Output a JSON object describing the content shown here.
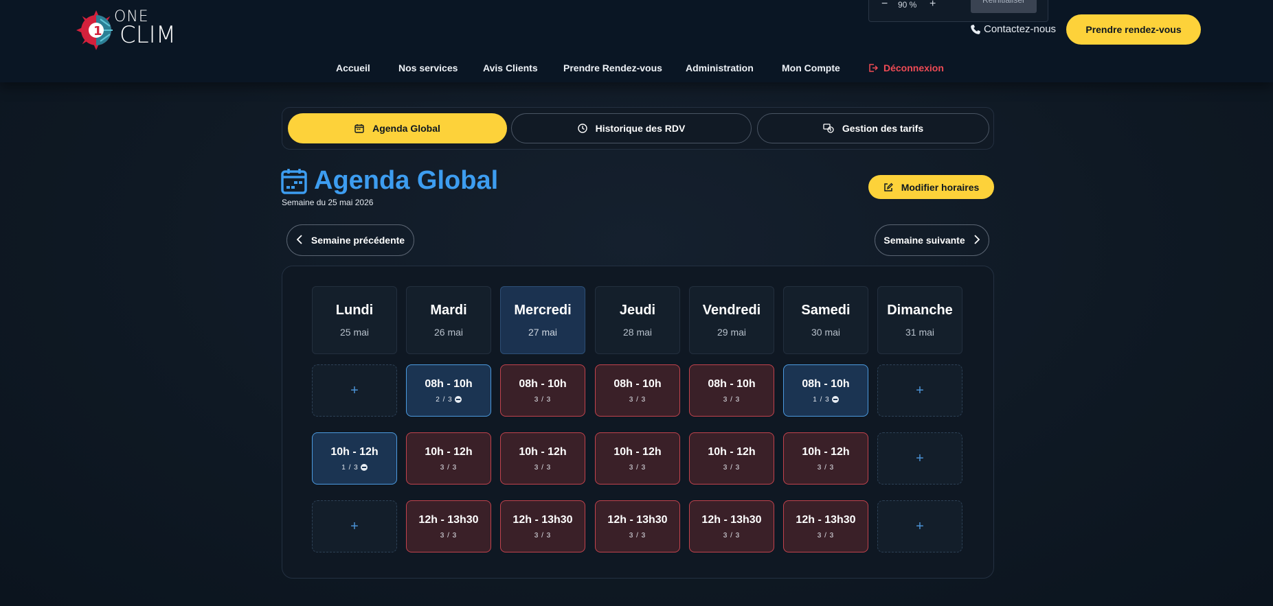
{
  "header": {
    "logo": {
      "one": "ONE",
      "clim": "CLIM"
    },
    "zoom": {
      "minus": "−",
      "value": "90 %",
      "plus": "+",
      "reset": "Réinitialiser"
    },
    "contact_label": "Contactez-nous",
    "cta_label": "Prendre rendez-vous"
  },
  "nav": {
    "items": [
      "Accueil",
      "Nos services",
      "Avis Clients",
      "Prendre Rendez-vous",
      "Administration",
      "Mon Compte"
    ],
    "logout": "Déconnexion"
  },
  "tabs": [
    {
      "label": "Agenda Global",
      "icon": "calendar-icon",
      "active": true
    },
    {
      "label": "Historique des RDV",
      "icon": "clock-icon",
      "active": false
    },
    {
      "label": "Gestion des tarifs",
      "icon": "price-tag-icon",
      "active": false
    }
  ],
  "page": {
    "title": "Agenda Global",
    "subtitle": "Semaine du 25 mai 2026",
    "edit_button": "Modifier horaires",
    "prev_week": "Semaine précédente",
    "next_week": "Semaine suivante"
  },
  "colors": {
    "accent_yellow": "#fdd23a",
    "title_blue": "#3d9df0",
    "full_border": "#c2434d",
    "partial_border": "#4c9be0",
    "logout_red": "#ef4b55"
  },
  "calendar": {
    "days": [
      {
        "name": "Lundi",
        "date": "25 mai",
        "today": false
      },
      {
        "name": "Mardi",
        "date": "26 mai",
        "today": false
      },
      {
        "name": "Mercredi",
        "date": "27 mai",
        "today": true
      },
      {
        "name": "Jeudi",
        "date": "28 mai",
        "today": false
      },
      {
        "name": "Vendredi",
        "date": "29 mai",
        "today": false
      },
      {
        "name": "Samedi",
        "date": "30 mai",
        "today": false
      },
      {
        "name": "Dimanche",
        "date": "31 mai",
        "today": false
      }
    ],
    "rows": [
      [
        {
          "type": "empty",
          "label": "+"
        },
        {
          "type": "partial",
          "time": "08h - 10h",
          "count": "2 / 3"
        },
        {
          "type": "full",
          "time": "08h - 10h",
          "count": "3 / 3"
        },
        {
          "type": "full",
          "time": "08h - 10h",
          "count": "3 / 3"
        },
        {
          "type": "full",
          "time": "08h - 10h",
          "count": "3 / 3"
        },
        {
          "type": "partial",
          "time": "08h - 10h",
          "count": "1 / 3"
        },
        {
          "type": "empty",
          "label": "+"
        }
      ],
      [
        {
          "type": "partial",
          "time": "10h - 12h",
          "count": "1 / 3"
        },
        {
          "type": "full",
          "time": "10h - 12h",
          "count": "3 / 3"
        },
        {
          "type": "full",
          "time": "10h - 12h",
          "count": "3 / 3"
        },
        {
          "type": "full",
          "time": "10h - 12h",
          "count": "3 / 3"
        },
        {
          "type": "full",
          "time": "10h - 12h",
          "count": "3 / 3"
        },
        {
          "type": "full",
          "time": "10h - 12h",
          "count": "3 / 3"
        },
        {
          "type": "empty",
          "label": "+"
        }
      ],
      [
        {
          "type": "empty",
          "label": "+"
        },
        {
          "type": "full",
          "time": "12h - 13h30",
          "count": "3 / 3"
        },
        {
          "type": "full",
          "time": "12h - 13h30",
          "count": "3 / 3"
        },
        {
          "type": "full",
          "time": "12h - 13h30",
          "count": "3 / 3"
        },
        {
          "type": "full",
          "time": "12h - 13h30",
          "count": "3 / 3"
        },
        {
          "type": "full",
          "time": "12h - 13h30",
          "count": "3 / 3"
        },
        {
          "type": "empty",
          "label": "+"
        }
      ]
    ]
  }
}
